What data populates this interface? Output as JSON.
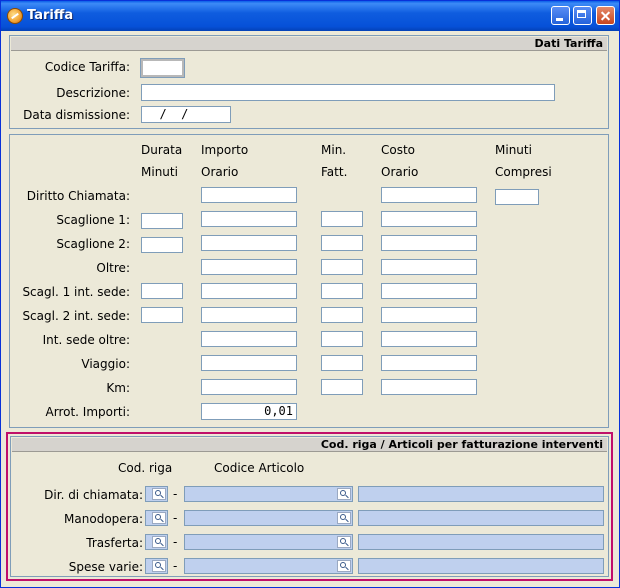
{
  "window": {
    "title": "Tariffa"
  },
  "dati": {
    "header": "Dati Tariffa",
    "codice_label": "Codice Tariffa:",
    "codice_value": "",
    "descrizione_label": "Descrizione:",
    "descrizione_value": "",
    "data_label": "Data dismissione:",
    "data_value": "  /  /"
  },
  "scaglioni": {
    "columns": {
      "durata": [
        "Durata",
        "Minuti"
      ],
      "importo": [
        "Importo",
        "Orario"
      ],
      "min": [
        "Min.",
        "Fatt."
      ],
      "costo": [
        "Costo",
        "Orario"
      ],
      "minuti": [
        "Minuti",
        "Compresi"
      ]
    },
    "rows": [
      {
        "label": "Diritto Chiamata:"
      },
      {
        "label": "Scaglione 1:"
      },
      {
        "label": "Scaglione 2:"
      },
      {
        "label": "Oltre:"
      },
      {
        "label": "Scagl. 1 int. sede:"
      },
      {
        "label": "Scagl. 2 int. sede:"
      },
      {
        "label": "Int. sede oltre:"
      },
      {
        "label": "Viaggio:"
      },
      {
        "label": "Km:"
      },
      {
        "label": "Arrot. Importi:"
      }
    ],
    "arrot_value": "0,01"
  },
  "articoli": {
    "header": "Cod. riga / Articoli per fatturazione interventi",
    "col_codriga": "Cod. riga",
    "col_codart": "Codice Articolo",
    "dash": "-",
    "rows": [
      {
        "label": "Dir. di chiamata:"
      },
      {
        "label": "Manodopera:"
      },
      {
        "label": "Trasferta:"
      },
      {
        "label": "Spese varie:"
      }
    ],
    "lookup_icon": "magnifier-icon"
  },
  "colors": {
    "accent": "#C0106A",
    "field_bg": "#BFD0EE",
    "titlebar": "#0A5FE8"
  }
}
